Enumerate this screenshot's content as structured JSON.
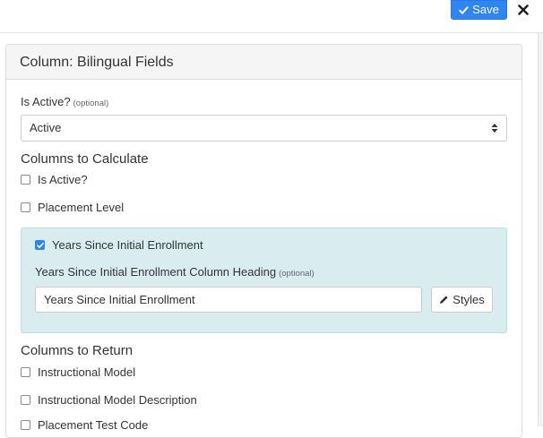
{
  "toolbar": {
    "save_label": "Save"
  },
  "panel": {
    "title": "Column: Bilingual Fields"
  },
  "is_active": {
    "label": "Is Active?",
    "optional": "(optional)",
    "value": "Active"
  },
  "calculate": {
    "title": "Columns to Calculate",
    "items": [
      {
        "label": "Is Active?",
        "checked": false
      },
      {
        "label": "Placement Level",
        "checked": false
      },
      {
        "label": "Years Since Initial Enrollment",
        "checked": true
      }
    ],
    "heading_field": {
      "label": "Years Since Initial Enrollment Column Heading",
      "optional": "(optional)",
      "value": "Years Since Initial Enrollment",
      "styles_label": "Styles"
    }
  },
  "return": {
    "title": "Columns to Return",
    "items": [
      {
        "label": "Instructional Model",
        "checked": false
      },
      {
        "label": "Instructional Model Description",
        "checked": false
      },
      {
        "label": "Placement Test Code",
        "checked": false
      }
    ]
  },
  "colors": {
    "accent": "#2f86f2",
    "well_bg": "#d9edf0"
  }
}
